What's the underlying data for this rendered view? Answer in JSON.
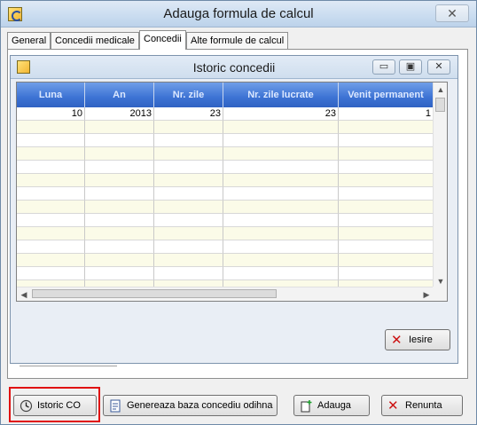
{
  "window": {
    "title": "Adauga formula de calcul",
    "close_label": "✕"
  },
  "tabs": [
    {
      "label": "General"
    },
    {
      "label": "Concedii medicale"
    },
    {
      "label": "Concedii"
    },
    {
      "label": "Alte formule de calcul"
    }
  ],
  "inner_window": {
    "title": "Istoric concedii",
    "minimize": "▭",
    "restore": "▣",
    "close": "✕"
  },
  "grid": {
    "columns": [
      "Luna",
      "An",
      "Nr. zile",
      "Nr. zile lucrate",
      "Venit permanent"
    ],
    "rows": [
      [
        "10",
        "2013",
        "23",
        "23",
        "1"
      ]
    ]
  },
  "buttons": {
    "iesire": "Iesire",
    "istoric_co": "Istoric CO",
    "genereaza": "Genereaza baza concediu odihna",
    "adauga": "Adauga",
    "renunta": "Renunta"
  },
  "colors": {
    "header_blue": "#3d73d4",
    "highlight_red": "#e01010",
    "row_alt": "#fbfbe8"
  }
}
